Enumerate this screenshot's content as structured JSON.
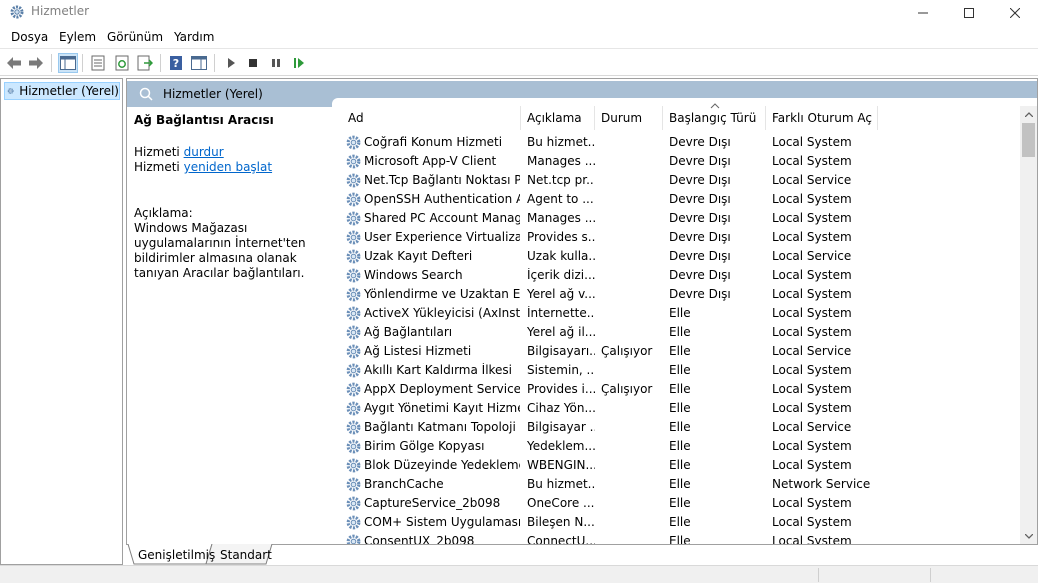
{
  "window": {
    "title": "Hizmetler"
  },
  "menu": [
    "Dosya",
    "Eylem",
    "Görünüm",
    "Yardım"
  ],
  "toolbar": [
    "back-icon",
    "forward-icon",
    "console-tree-icon",
    "properties-icon",
    "refresh-icon",
    "export-list-icon",
    "help-icon",
    "show-hide-icon",
    "start-icon",
    "stop-icon",
    "pause-icon",
    "resume-icon"
  ],
  "tree": {
    "root_label": "Hizmetler (Yerel)"
  },
  "pane": {
    "header_label": "Hizmetler (Yerel)",
    "selected_service": "Ağ Bağlantısı Aracısı",
    "prefix": "Hizmeti",
    "action_stop": "durdur",
    "action_restart": "yeniden başlat",
    "desc_label": "Açıklama:",
    "desc_text": "Windows Mağazası uygulamalarının İnternet'ten bildirimler almasına olanak tanıyan Aracılar bağlantıları."
  },
  "columns": [
    "Ad",
    "Açıklama",
    "Durum",
    "Başlangıç Türü",
    "Farklı Oturum Aç"
  ],
  "rows": [
    [
      "Coğrafi Konum Hizmeti",
      "Bu hizmet...",
      "",
      "Devre Dışı",
      "Local System"
    ],
    [
      "Microsoft App-V Client",
      "Manages ...",
      "",
      "Devre Dışı",
      "Local System"
    ],
    [
      "Net.Tcp Bağlantı Noktası Pa...",
      "Net.tcp pr...",
      "",
      "Devre Dışı",
      "Local Service"
    ],
    [
      "OpenSSH Authentication A...",
      "Agent to ...",
      "",
      "Devre Dışı",
      "Local System"
    ],
    [
      "Shared PC Account Manager",
      "Manages ...",
      "",
      "Devre Dışı",
      "Local System"
    ],
    [
      "User Experience Virtualizatio...",
      "Provides s...",
      "",
      "Devre Dışı",
      "Local System"
    ],
    [
      "Uzak Kayıt Defteri",
      "Uzak kulla...",
      "",
      "Devre Dışı",
      "Local Service"
    ],
    [
      "Windows Search",
      "İçerik dizi...",
      "",
      "Devre Dışı",
      "Local System"
    ],
    [
      "Yönlendirme ve Uzaktan Eri...",
      "Yerel ağ v...",
      "",
      "Devre Dışı",
      "Local System"
    ],
    [
      "ActiveX Yükleyicisi (AxInstSV)",
      "İnternette...",
      "",
      "Elle",
      "Local System"
    ],
    [
      "Ağ Bağlantıları",
      "Yerel ağ il...",
      "",
      "Elle",
      "Local System"
    ],
    [
      "Ağ Listesi Hizmeti",
      "Bilgisayarı...",
      "Çalışıyor",
      "Elle",
      "Local Service"
    ],
    [
      "Akıllı Kart Kaldırma İlkesi",
      "Sistemin, ...",
      "",
      "Elle",
      "Local System"
    ],
    [
      "AppX Deployment Service (...",
      "Provides i...",
      "Çalışıyor",
      "Elle",
      "Local System"
    ],
    [
      "Aygıt Yönetimi Kayıt Hizmeti",
      "Cihaz Yön...",
      "",
      "Elle",
      "Local System"
    ],
    [
      "Bağlantı Katmanı Topoloji B...",
      "Bilgisayar ...",
      "",
      "Elle",
      "Local Service"
    ],
    [
      "Birim Gölge Kopyası",
      "Yedeklem...",
      "",
      "Elle",
      "Local System"
    ],
    [
      "Blok Düzeyinde Yedekleme ...",
      "WBENGIN...",
      "",
      "Elle",
      "Local System"
    ],
    [
      "BranchCache",
      "Bu hizmet...",
      "",
      "Elle",
      "Network Service"
    ],
    [
      "CaptureService_2b098",
      "OneCore ...",
      "",
      "Elle",
      "Local System"
    ],
    [
      "COM+ Sistem Uygulaması",
      "Bileşen N...",
      "",
      "Elle",
      "Local System"
    ],
    [
      "ConsentUX_2b098",
      "ConnectU...",
      "",
      "Elle",
      "Local System"
    ]
  ],
  "tabs": [
    "Genişletilmiş",
    "Standart"
  ],
  "colors": {
    "header": "#a9bfd4",
    "selection": "#cce8ff",
    "link": "#0066cc"
  }
}
